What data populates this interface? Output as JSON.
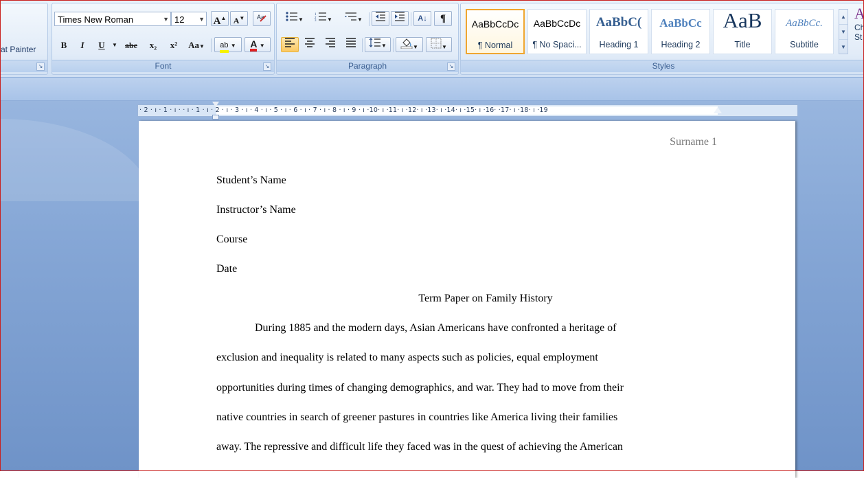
{
  "clipboard": {
    "format_painter": "at Painter"
  },
  "font": {
    "group_label": "Font",
    "family": "Times New Roman",
    "size": "12",
    "grow": "A",
    "shrink": "A",
    "bold": "B",
    "italic": "I",
    "underline": "U",
    "strikethrough": "abe",
    "subscript": "x₂",
    "superscript": "x²",
    "change_case": "Aa",
    "highlight": "ab",
    "font_color": "A"
  },
  "paragraph": {
    "group_label": "Paragraph",
    "sort": "A↓",
    "pilcrow": "¶"
  },
  "styles": {
    "group_label": "Styles",
    "items": [
      {
        "sample": "AaBbCcDc",
        "name": "¶ Normal"
      },
      {
        "sample": "AaBbCcDc",
        "name": "¶ No Spaci..."
      },
      {
        "sample": "AaBbC(",
        "name": "Heading 1"
      },
      {
        "sample": "AaBbCc",
        "name": "Heading 2"
      },
      {
        "sample": "AaB",
        "name": "Title"
      },
      {
        "sample": "AaBbCc.",
        "name": "Subtitle"
      }
    ],
    "change_styles_glyph": "A",
    "change_styles_label": "Ch\nSt"
  },
  "ruler": {
    "text": "· 2 · ı · 1 · ı ·   · ı · 1 · ı · 2 · ı · 3 · ı · 4 · ı · 5 · ı · 6 · ı · 7 · ı · 8 · ı · 9 · ı ·10· ı ·11· ı ·12· ı ·13· ı ·14· ı ·15· ı ·16·   ·17· ı ·18· ı ·19"
  },
  "document": {
    "header": "Surname 1",
    "lines": [
      "Student’s Name",
      "Instructor’s Name",
      "Course",
      "Date"
    ],
    "title": "Term Paper on Family History",
    "body": [
      "During 1885 and the modern days, Asian Americans have confronted a heritage of",
      "exclusion and inequality is related to many aspects such as policies, equal employment",
      "opportunities during times of changing demographics, and war. They had to move from their",
      "native countries in search of greener pastures in countries like America living their families",
      "away. The repressive and difficult life they faced was in the quest of achieving the American"
    ]
  },
  "colors": {
    "accent_selected": "#f0a62f",
    "ribbon_blue": "#3b5f91",
    "font_color_bar": "#e02020",
    "highlight_bar": "#f6f200"
  }
}
